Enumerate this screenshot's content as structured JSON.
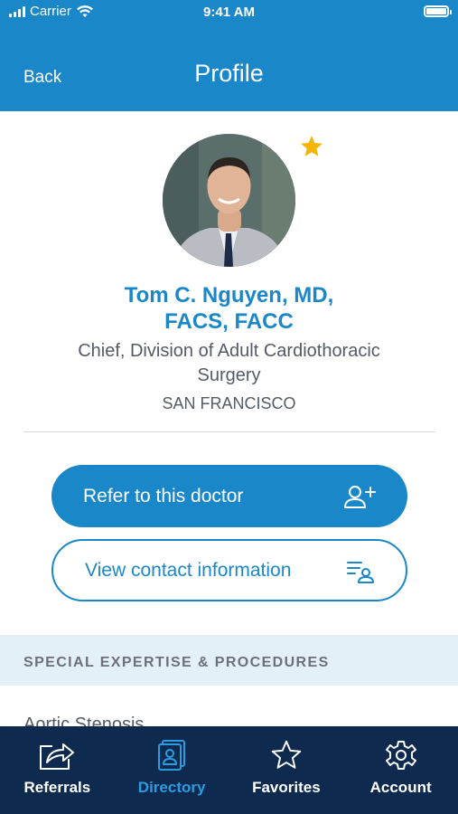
{
  "status_bar": {
    "carrier": "Carrier",
    "time": "9:41 AM"
  },
  "nav": {
    "back_label": "Back",
    "title": "Profile"
  },
  "profile": {
    "name_line1": "Tom C. Nguyen, MD,",
    "name_line2": "FACS, FACC",
    "role_line1": "Chief, Division of Adult Cardiothoracic",
    "role_line2": "Surgery",
    "location": "SAN FRANCISCO",
    "favorited": true
  },
  "actions": {
    "refer_label": "Refer to this doctor",
    "contact_label": "View contact information"
  },
  "expertise": {
    "section_title": "SPECIAL EXPERTISE & PROCEDURES",
    "items": [
      "Aortic Stenosis"
    ]
  },
  "tabbar": {
    "tabs": [
      {
        "label": "Referrals",
        "icon": "share-icon",
        "active": false
      },
      {
        "label": "Directory",
        "icon": "directory-icon",
        "active": true
      },
      {
        "label": "Favorites",
        "icon": "star-outline-icon",
        "active": false
      },
      {
        "label": "Account",
        "icon": "gear-icon",
        "active": false
      }
    ]
  },
  "colors": {
    "primary": "#1a87c9",
    "tabbar_bg": "#0f2a4f",
    "tab_active": "#2c9be0",
    "favorite_star": "#f5b400",
    "section_bg": "#e4f0f8"
  }
}
